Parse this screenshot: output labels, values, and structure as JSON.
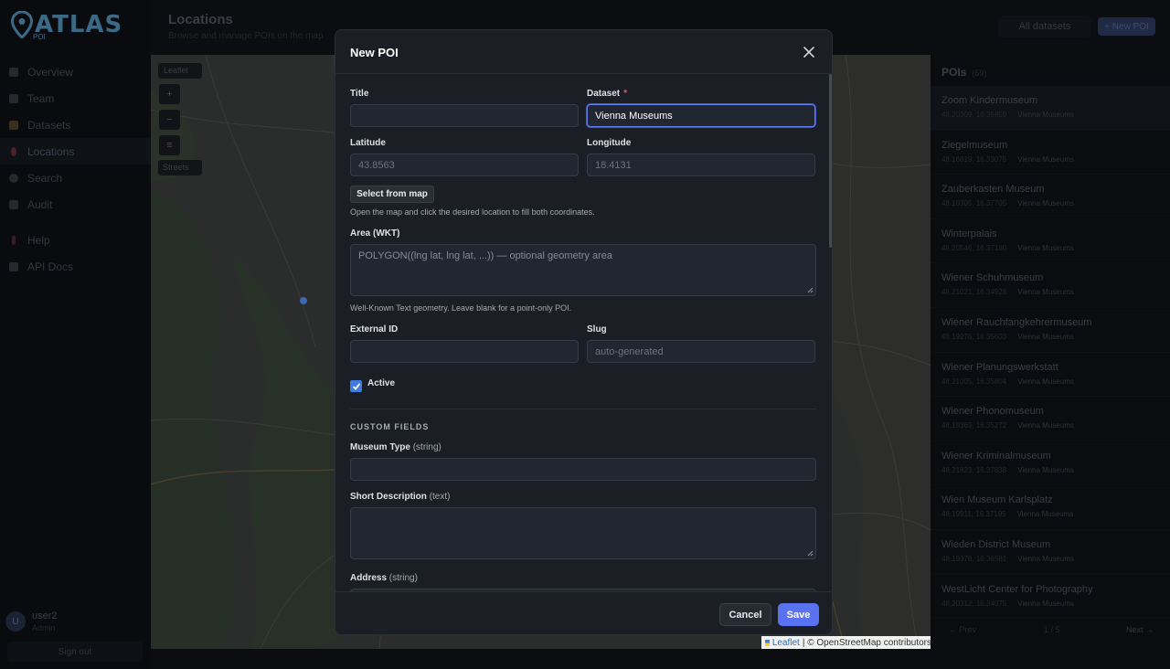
{
  "app": {
    "logo_text": "ATLAS",
    "logo_sub": "POI"
  },
  "sidebar": {
    "items": [
      {
        "label": "Overview",
        "icon": "grid-icon"
      },
      {
        "label": "Team",
        "icon": "users-icon"
      },
      {
        "label": "Datasets",
        "icon": "database-icon"
      },
      {
        "label": "Locations",
        "icon": "pin-icon",
        "active": true
      },
      {
        "label": "Search",
        "icon": "search-icon"
      },
      {
        "label": "Audit",
        "icon": "audit-icon"
      },
      {
        "label": "Help",
        "icon": "help-icon"
      },
      {
        "label": "API Docs",
        "icon": "doc-icon"
      }
    ],
    "user": {
      "initial": "U",
      "name": "user2",
      "role": "Admin"
    },
    "signout_label": "Sign out"
  },
  "header": {
    "title": "Locations",
    "subtitle": "Browse and manage POIs on the map",
    "datasets_filter": "All datasets",
    "new_poi_label": "+ New POI"
  },
  "map": {
    "leaflet_label": "Leaflet",
    "zoom_in": "+",
    "zoom_out": "−",
    "layers": "≡",
    "streets_label": "Streets",
    "attribution_leaflet": "Leaflet",
    "attribution_osm": "| © OpenStreetMap contributors"
  },
  "poi_panel": {
    "title": "POIs",
    "count": "(59)",
    "items": [
      {
        "name": "Zoom Kindermuseum",
        "coords": "48.20309, 16.35859",
        "dataset": "Vienna Museums",
        "selected": true
      },
      {
        "name": "Ziegelmuseum",
        "coords": "48.16819, 16.33075",
        "dataset": "Vienna Museums"
      },
      {
        "name": "Zauberkasten Museum",
        "coords": "48.19305, 16.37705",
        "dataset": "Vienna Museums"
      },
      {
        "name": "Winterpalais",
        "coords": "48.20546, 16.37180",
        "dataset": "Vienna Museums"
      },
      {
        "name": "Wiener Schuhmuseum",
        "coords": "48.21021, 16.34928",
        "dataset": "Vienna Museums"
      },
      {
        "name": "Wiener Rauchfangkehrermuseum",
        "coords": "48.19276, 16.35603",
        "dataset": "Vienna Museums"
      },
      {
        "name": "Wiener Planungswerkstatt",
        "coords": "48.21005, 16.35804",
        "dataset": "Vienna Museums"
      },
      {
        "name": "Wiener Phonomuseum",
        "coords": "48.19369, 16.35272",
        "dataset": "Vienna Museums"
      },
      {
        "name": "Wiener Kriminalmuseum",
        "coords": "48.21823, 16.37838",
        "dataset": "Vienna Museums"
      },
      {
        "name": "Wien Museum Karlsplatz",
        "coords": "48.19911, 16.37195",
        "dataset": "Vienna Museums"
      },
      {
        "name": "Wieden District Museum",
        "coords": "48.19378, 16.36581",
        "dataset": "Vienna Museums"
      },
      {
        "name": "WestLicht Center for Photography",
        "coords": "48.20312, 16.34075",
        "dataset": "Vienna Museums"
      }
    ],
    "pager": {
      "prev": "← Prev",
      "page": "1 / 5",
      "next": "Next →"
    }
  },
  "modal": {
    "title": "New POI",
    "fields": {
      "title": {
        "label": "Title",
        "value": ""
      },
      "dataset": {
        "label": "Dataset",
        "required": "*",
        "value": "Vienna Museums"
      },
      "latitude": {
        "label": "Latitude",
        "placeholder": "43.8563"
      },
      "longitude": {
        "label": "Longitude",
        "placeholder": "18.4131"
      },
      "select_from_map": "Select from map",
      "select_help": "Open the map and click the desired location to fill both coordinates.",
      "area": {
        "label": "Area (WKT)",
        "placeholder": "POLYGON((lng lat, lng lat, ...)) — optional geometry area",
        "help": "Well-Known Text geometry. Leave blank for a point-only POI."
      },
      "external_id": {
        "label": "External ID",
        "value": ""
      },
      "slug": {
        "label": "Slug",
        "placeholder": "auto-generated"
      },
      "active": {
        "label": "Active",
        "checked": true
      }
    },
    "custom_fields": {
      "heading": "CUSTOM FIELDS",
      "museum_type": {
        "label": "Museum Type",
        "type": "(string)"
      },
      "short_description": {
        "label": "Short Description",
        "type": "(text)"
      },
      "address": {
        "label": "Address",
        "type": "(string)"
      }
    },
    "cancel_label": "Cancel",
    "save_label": "Save"
  },
  "colors": {
    "accent": "#5a72f0",
    "focus_border": "#5b7ff0",
    "required": "#f05a5a",
    "checkbox": "#3f7be0"
  }
}
